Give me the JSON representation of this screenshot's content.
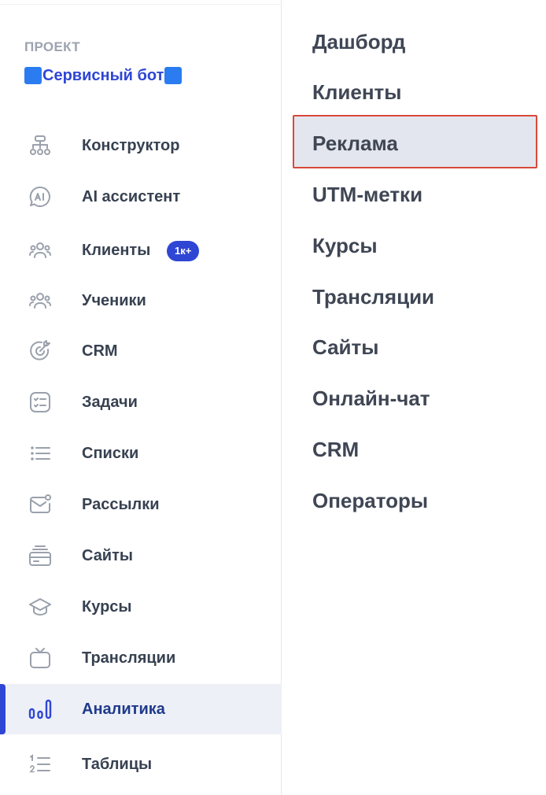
{
  "project": {
    "label": "ПРОЕКТ",
    "name": "Сервисный бот",
    "square_color": "#2b7cf0"
  },
  "sidebar": {
    "items": [
      {
        "label": "Конструктор",
        "icon": "sitemap-icon"
      },
      {
        "label": "AI ассистент",
        "icon": "ai-chat-icon"
      },
      {
        "label": "Клиенты",
        "icon": "users-icon",
        "badge": "1к+"
      },
      {
        "label": "Ученики",
        "icon": "students-icon"
      },
      {
        "label": "CRM",
        "icon": "target-icon"
      },
      {
        "label": "Задачи",
        "icon": "task-list-icon"
      },
      {
        "label": "Списки",
        "icon": "list-icon"
      },
      {
        "label": "Рассылки",
        "icon": "mail-icon"
      },
      {
        "label": "Сайты",
        "icon": "website-icon"
      },
      {
        "label": "Курсы",
        "icon": "graduation-cap-icon"
      },
      {
        "label": "Трансляции",
        "icon": "tv-icon"
      },
      {
        "label": "Аналитика",
        "icon": "analytics-icon",
        "active": true
      },
      {
        "label": "Таблицы",
        "icon": "numbered-list-icon"
      }
    ]
  },
  "submenu": {
    "items": [
      {
        "label": "Дашборд"
      },
      {
        "label": "Клиенты"
      },
      {
        "label": "Реклама",
        "highlighted": true
      },
      {
        "label": "UTM-метки"
      },
      {
        "label": "Курсы"
      },
      {
        "label": "Трансляции"
      },
      {
        "label": "Сайты"
      },
      {
        "label": "Онлайн-чат"
      },
      {
        "label": "CRM"
      },
      {
        "label": "Операторы"
      }
    ]
  },
  "colors": {
    "accent": "#2f46d5",
    "highlight_border": "#d9483b"
  }
}
